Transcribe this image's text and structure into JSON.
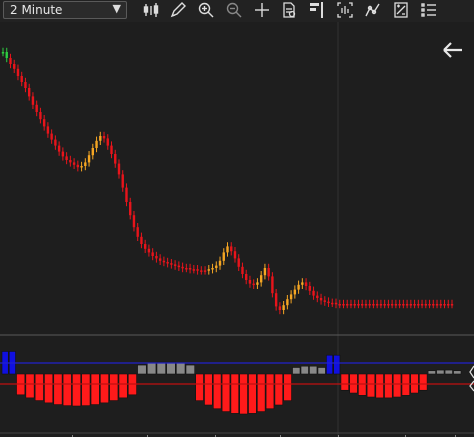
{
  "toolbar": {
    "timeframe": "2 Minute",
    "icons": [
      "bar-chart-style-icon",
      "pencil-draw-icon",
      "zoom-in-icon",
      "zoom-out-icon",
      "crosshair-icon",
      "data-box-icon",
      "chart-trader-icon",
      "properties-icon",
      "indicators-icon",
      "strategies-icon",
      "templates-icon"
    ]
  },
  "colors": {
    "background": "#1e1e1e",
    "bull_strong": "#2ecc40",
    "trend_up": "#f5a623",
    "trend_down": "#e8141b",
    "volume_blue": "#1010e0",
    "volume_gray": "#888888",
    "volume_red": "#ff1a1a",
    "line_blue": "#2222cc",
    "line_red": "#c01010"
  },
  "chart_data": {
    "type": "line",
    "price_series": {
      "name": "",
      "x": [
        0,
        2,
        4,
        6,
        8,
        10,
        12,
        14,
        16,
        18,
        20,
        22,
        24,
        26,
        28,
        30,
        32,
        34,
        36,
        38,
        40,
        42,
        44,
        46,
        48,
        50,
        52,
        54,
        56,
        58,
        60,
        62,
        64,
        66,
        68,
        70,
        72,
        74,
        76,
        78,
        80,
        82,
        84,
        86,
        88,
        90,
        92,
        94,
        96,
        98,
        100,
        102,
        104,
        106,
        108,
        110,
        112,
        114,
        116,
        118,
        120,
        122,
        124,
        126,
        128,
        130,
        132,
        134,
        136,
        138,
        140,
        142,
        144,
        146,
        148,
        150,
        152,
        154,
        156,
        158,
        160,
        162,
        164,
        166,
        168,
        170,
        172,
        174,
        176,
        178,
        180,
        182,
        184,
        186,
        188,
        190,
        192,
        194,
        196,
        198,
        200,
        202,
        204,
        206,
        208,
        210,
        212,
        214,
        216,
        218,
        220,
        222,
        224,
        226,
        228,
        230,
        232,
        234,
        236,
        238,
        240
      ],
      "y": [
        100,
        99.5,
        99,
        98.6,
        98,
        97.5,
        97,
        96.3,
        95.6,
        95,
        94.4,
        93.8,
        93.2,
        92.7,
        92.2,
        91.7,
        91.3,
        91,
        90.8,
        90.6,
        90.4,
        90.5,
        90.8,
        91.4,
        92,
        92.6,
        93,
        92.8,
        92.2,
        91.5,
        90.7,
        89.8,
        88.7,
        87.5,
        86.4,
        85.4,
        84.6,
        84,
        83.6,
        83.3,
        83,
        82.8,
        82.6,
        82.5,
        82.4,
        82.3,
        82.2,
        82.1,
        82,
        82,
        81.9,
        81.9,
        81.8,
        81.8,
        81.8,
        81.9,
        82,
        82.2,
        82.6,
        83.3,
        83.8,
        83.4,
        82.8,
        82.1,
        81.5,
        81,
        80.7,
        80.6,
        80.8,
        81.4,
        82,
        81.3,
        79.9,
        78.8,
        78.5,
        78.9,
        79.4,
        79.8,
        80.2,
        80.6,
        80.8,
        80.5,
        80.1,
        79.7,
        79.5,
        79.3,
        79.2,
        79.1,
        79.1,
        79,
        79,
        79,
        79,
        79,
        79,
        79,
        79,
        79,
        79,
        79,
        79,
        79,
        79,
        79,
        79,
        79,
        79,
        79,
        79,
        79,
        79,
        79,
        79,
        79,
        79,
        79,
        79,
        79,
        79,
        79,
        79
      ]
    },
    "sub_panel": {
      "levels": [
        "blue-upper",
        "red-lower"
      ],
      "segments": [
        {
          "from": 0,
          "to": 3,
          "kind": "blue",
          "value": 0.6
        },
        {
          "from": 3,
          "to": 28,
          "kind": "red",
          "value": -0.8
        },
        {
          "from": 28,
          "to": 40,
          "kind": "gray",
          "value": 0.3
        },
        {
          "from": 40,
          "to": 60,
          "kind": "red",
          "value": -1.0
        },
        {
          "from": 60,
          "to": 67,
          "kind": "gray",
          "value": 0.2
        },
        {
          "from": 67,
          "to": 70,
          "kind": "blue",
          "value": 0.5
        },
        {
          "from": 70,
          "to": 88,
          "kind": "red",
          "value": -0.6
        },
        {
          "from": 88,
          "to": 95,
          "kind": "gray",
          "value": 0.1
        }
      ]
    }
  }
}
